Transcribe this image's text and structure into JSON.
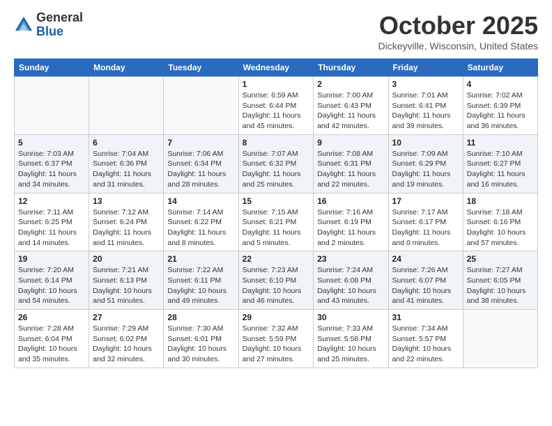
{
  "logo": {
    "general": "General",
    "blue": "Blue"
  },
  "header": {
    "month": "October 2025",
    "location": "Dickeyville, Wisconsin, United States"
  },
  "weekdays": [
    "Sunday",
    "Monday",
    "Tuesday",
    "Wednesday",
    "Thursday",
    "Friday",
    "Saturday"
  ],
  "weeks": [
    [
      {
        "day": "",
        "info": ""
      },
      {
        "day": "",
        "info": ""
      },
      {
        "day": "",
        "info": ""
      },
      {
        "day": "1",
        "info": "Sunrise: 6:59 AM\nSunset: 6:44 PM\nDaylight: 11 hours\nand 45 minutes."
      },
      {
        "day": "2",
        "info": "Sunrise: 7:00 AM\nSunset: 6:43 PM\nDaylight: 11 hours\nand 42 minutes."
      },
      {
        "day": "3",
        "info": "Sunrise: 7:01 AM\nSunset: 6:41 PM\nDaylight: 11 hours\nand 39 minutes."
      },
      {
        "day": "4",
        "info": "Sunrise: 7:02 AM\nSunset: 6:39 PM\nDaylight: 11 hours\nand 36 minutes."
      }
    ],
    [
      {
        "day": "5",
        "info": "Sunrise: 7:03 AM\nSunset: 6:37 PM\nDaylight: 11 hours\nand 34 minutes."
      },
      {
        "day": "6",
        "info": "Sunrise: 7:04 AM\nSunset: 6:36 PM\nDaylight: 11 hours\nand 31 minutes."
      },
      {
        "day": "7",
        "info": "Sunrise: 7:06 AM\nSunset: 6:34 PM\nDaylight: 11 hours\nand 28 minutes."
      },
      {
        "day": "8",
        "info": "Sunrise: 7:07 AM\nSunset: 6:32 PM\nDaylight: 11 hours\nand 25 minutes."
      },
      {
        "day": "9",
        "info": "Sunrise: 7:08 AM\nSunset: 6:31 PM\nDaylight: 11 hours\nand 22 minutes."
      },
      {
        "day": "10",
        "info": "Sunrise: 7:09 AM\nSunset: 6:29 PM\nDaylight: 11 hours\nand 19 minutes."
      },
      {
        "day": "11",
        "info": "Sunrise: 7:10 AM\nSunset: 6:27 PM\nDaylight: 11 hours\nand 16 minutes."
      }
    ],
    [
      {
        "day": "12",
        "info": "Sunrise: 7:11 AM\nSunset: 6:25 PM\nDaylight: 11 hours\nand 14 minutes."
      },
      {
        "day": "13",
        "info": "Sunrise: 7:12 AM\nSunset: 6:24 PM\nDaylight: 11 hours\nand 11 minutes."
      },
      {
        "day": "14",
        "info": "Sunrise: 7:14 AM\nSunset: 6:22 PM\nDaylight: 11 hours\nand 8 minutes."
      },
      {
        "day": "15",
        "info": "Sunrise: 7:15 AM\nSunset: 6:21 PM\nDaylight: 11 hours\nand 5 minutes."
      },
      {
        "day": "16",
        "info": "Sunrise: 7:16 AM\nSunset: 6:19 PM\nDaylight: 11 hours\nand 2 minutes."
      },
      {
        "day": "17",
        "info": "Sunrise: 7:17 AM\nSunset: 6:17 PM\nDaylight: 11 hours\nand 0 minutes."
      },
      {
        "day": "18",
        "info": "Sunrise: 7:18 AM\nSunset: 6:16 PM\nDaylight: 10 hours\nand 57 minutes."
      }
    ],
    [
      {
        "day": "19",
        "info": "Sunrise: 7:20 AM\nSunset: 6:14 PM\nDaylight: 10 hours\nand 54 minutes."
      },
      {
        "day": "20",
        "info": "Sunrise: 7:21 AM\nSunset: 6:13 PM\nDaylight: 10 hours\nand 51 minutes."
      },
      {
        "day": "21",
        "info": "Sunrise: 7:22 AM\nSunset: 6:11 PM\nDaylight: 10 hours\nand 49 minutes."
      },
      {
        "day": "22",
        "info": "Sunrise: 7:23 AM\nSunset: 6:10 PM\nDaylight: 10 hours\nand 46 minutes."
      },
      {
        "day": "23",
        "info": "Sunrise: 7:24 AM\nSunset: 6:08 PM\nDaylight: 10 hours\nand 43 minutes."
      },
      {
        "day": "24",
        "info": "Sunrise: 7:26 AM\nSunset: 6:07 PM\nDaylight: 10 hours\nand 41 minutes."
      },
      {
        "day": "25",
        "info": "Sunrise: 7:27 AM\nSunset: 6:05 PM\nDaylight: 10 hours\nand 38 minutes."
      }
    ],
    [
      {
        "day": "26",
        "info": "Sunrise: 7:28 AM\nSunset: 6:04 PM\nDaylight: 10 hours\nand 35 minutes."
      },
      {
        "day": "27",
        "info": "Sunrise: 7:29 AM\nSunset: 6:02 PM\nDaylight: 10 hours\nand 32 minutes."
      },
      {
        "day": "28",
        "info": "Sunrise: 7:30 AM\nSunset: 6:01 PM\nDaylight: 10 hours\nand 30 minutes."
      },
      {
        "day": "29",
        "info": "Sunrise: 7:32 AM\nSunset: 5:59 PM\nDaylight: 10 hours\nand 27 minutes."
      },
      {
        "day": "30",
        "info": "Sunrise: 7:33 AM\nSunset: 5:58 PM\nDaylight: 10 hours\nand 25 minutes."
      },
      {
        "day": "31",
        "info": "Sunrise: 7:34 AM\nSunset: 5:57 PM\nDaylight: 10 hours\nand 22 minutes."
      },
      {
        "day": "",
        "info": ""
      }
    ]
  ]
}
